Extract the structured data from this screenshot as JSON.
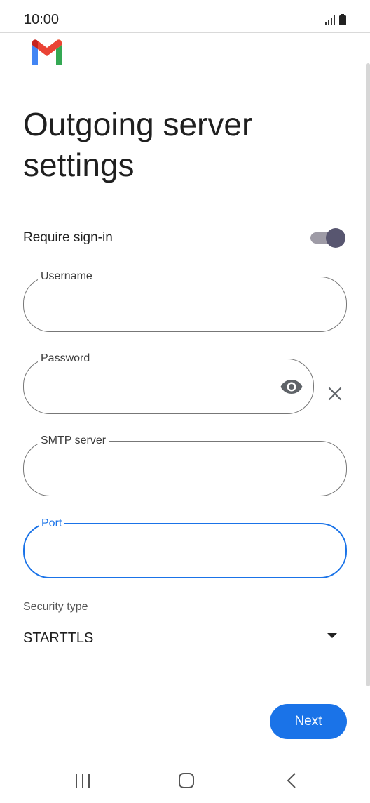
{
  "status_bar": {
    "time": "10:00",
    "icons": [
      "signal-icon",
      "battery-icon"
    ]
  },
  "app": {
    "logo": "gmail-logo",
    "title": "Outgoing server settings"
  },
  "require_signin": {
    "label": "Require sign-in",
    "enabled": true
  },
  "fields": {
    "username": {
      "label": "Username",
      "value": ""
    },
    "password": {
      "label": "Password",
      "value": ""
    },
    "smtp": {
      "label": "SMTP server",
      "value": ""
    },
    "port": {
      "label": "Port",
      "value": ""
    }
  },
  "security": {
    "label": "Security type",
    "value": "STARTTLS"
  },
  "actions": {
    "next_label": "Next"
  },
  "nav": [
    "recent-apps-icon",
    "home-icon",
    "back-icon"
  ],
  "colors": {
    "accent": "#1a73e8",
    "toggle_thumb": "#585670",
    "toggle_track": "#9e9ba6"
  }
}
